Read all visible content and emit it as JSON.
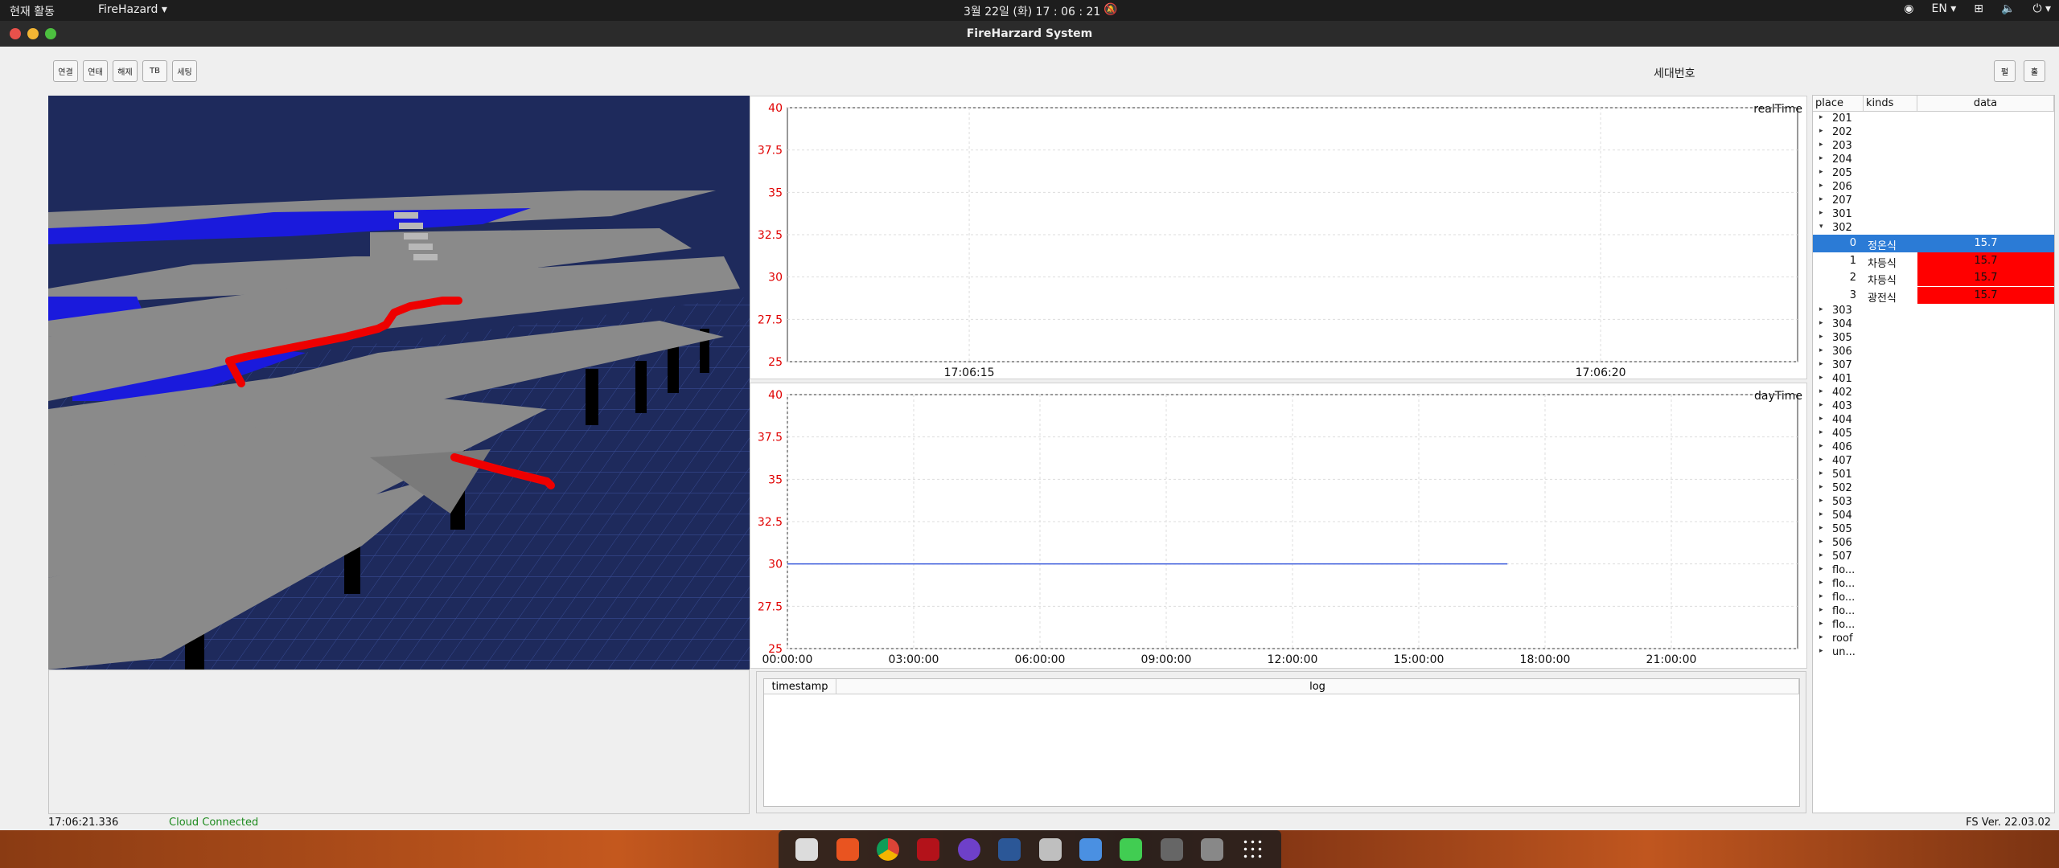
{
  "topbar": {
    "activities": "현재 활동",
    "app_menu": "FireHazard ▾",
    "clock": "3월 22일 (화)  17 : 06 : 21",
    "lang": "EN ▾"
  },
  "window": {
    "title": "FireHarzard System"
  },
  "toolbar": {
    "buttons": [
      "연결",
      "연태",
      "해제",
      "TB",
      "세팅"
    ]
  },
  "header": {
    "label": "세대번호",
    "right_buttons": [
      "펄",
      "홀"
    ]
  },
  "chart_data": [
    {
      "type": "line",
      "title": "realTime",
      "ylim": [
        25,
        40
      ],
      "yticks": [
        "40",
        "37.5",
        "35",
        "32.5",
        "30",
        "27.5",
        "25"
      ],
      "xticks": [
        "17:06:15",
        "17:06:20"
      ],
      "series": [],
      "grid": true
    },
    {
      "type": "line",
      "title": "dayTime",
      "ylim": [
        25,
        40
      ],
      "yticks": [
        "40",
        "37.5",
        "35",
        "32.5",
        "30",
        "27.5",
        "25"
      ],
      "xticks": [
        "00:00:00",
        "03:00:00",
        "06:00:00",
        "09:00:00",
        "12:00:00",
        "15:00:00",
        "18:00:00",
        "21:00:00"
      ],
      "series": [
        {
          "x": [
            "00:00:00",
            "17:06:21"
          ],
          "y": [
            30,
            30
          ]
        }
      ],
      "grid": true,
      "line_color": "#3b5bdb"
    }
  ],
  "log": {
    "columns": [
      "timestamp",
      "log"
    ],
    "rows": []
  },
  "tree": {
    "columns": [
      "place",
      "kinds",
      "data"
    ],
    "before": [
      "201",
      "202",
      "203",
      "204",
      "205",
      "206",
      "207",
      "301"
    ],
    "expanded": "302",
    "children": [
      {
        "idx": "0",
        "kind": "정온식",
        "value": "15.7",
        "state": "selected"
      },
      {
        "idx": "1",
        "kind": "차등식",
        "value": "15.7",
        "state": "alarm"
      },
      {
        "idx": "2",
        "kind": "차등식",
        "value": "15.7",
        "state": "alarm"
      },
      {
        "idx": "3",
        "kind": "광전식",
        "value": "15.7",
        "state": "alarm"
      }
    ],
    "after": [
      "303",
      "304",
      "305",
      "306",
      "307",
      "401",
      "402",
      "403",
      "404",
      "405",
      "406",
      "407",
      "501",
      "502",
      "503",
      "504",
      "505",
      "506",
      "507",
      "flo...",
      "flo...",
      "flo...",
      "flo...",
      "flo...",
      "roof",
      "un..."
    ]
  },
  "status": {
    "time": "17:06:21.336",
    "cloud": "Cloud Connected",
    "version": "FS Ver. 22.03.02"
  },
  "colors": {
    "alarm": "#ff0000",
    "selected": "#2b7bd6",
    "pipe_blue": "#0000ff",
    "pipe_red": "#ee0000",
    "scene_bg": "#1e2a5c"
  }
}
